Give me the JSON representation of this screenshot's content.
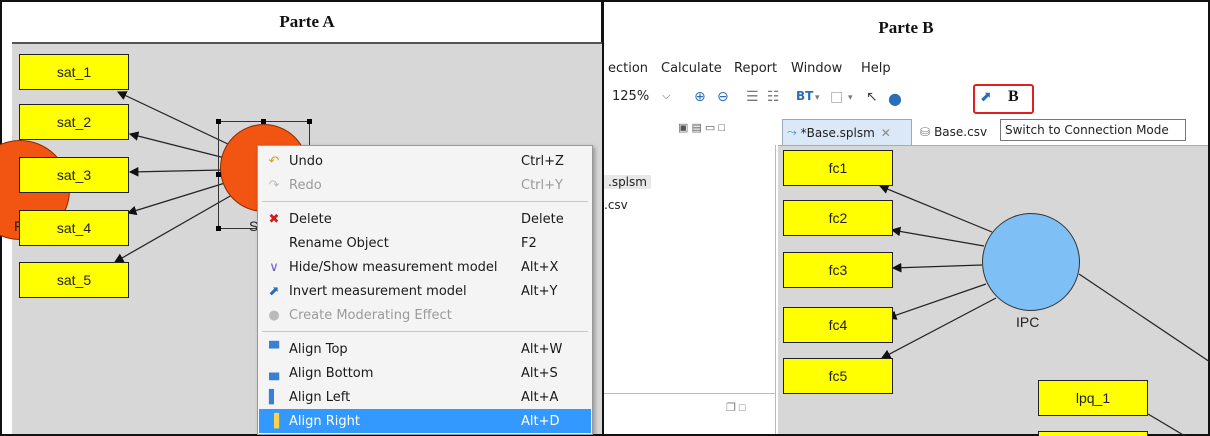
{
  "panel_a": {
    "title": "Parte A",
    "indicators": [
      "sat_1",
      "sat_2",
      "sat_3",
      "sat_4",
      "sat_5"
    ],
    "circle_label_left": "F",
    "circle_label_main": "S",
    "context_menu": [
      {
        "label": "Undo",
        "shortcut": "Ctrl+Z",
        "icon": "undo-icon",
        "disabled": false
      },
      {
        "label": "Redo",
        "shortcut": "Ctrl+Y",
        "icon": "redo-icon",
        "disabled": true
      },
      {
        "label": "Delete",
        "shortcut": "Delete",
        "icon": "delete-icon",
        "disabled": false
      },
      {
        "label": "Rename Object",
        "shortcut": "F2",
        "icon": "",
        "disabled": false
      },
      {
        "label": "Hide/Show measurement model",
        "shortcut": "Alt+X",
        "icon": "hide-show-icon",
        "disabled": false
      },
      {
        "label": "Invert measurement model",
        "shortcut": "Alt+Y",
        "icon": "invert-icon",
        "disabled": false
      },
      {
        "label": "Create Moderating Effect",
        "shortcut": "",
        "icon": "moderating-icon",
        "disabled": true
      },
      {
        "label": "Align Top",
        "shortcut": "Alt+W",
        "icon": "align-top-icon",
        "disabled": false
      },
      {
        "label": "Align Bottom",
        "shortcut": "Alt+S",
        "icon": "align-bottom-icon",
        "disabled": false
      },
      {
        "label": "Align Left",
        "shortcut": "Alt+A",
        "icon": "align-left-icon",
        "disabled": false
      },
      {
        "label": "Align Right",
        "shortcut": "Alt+D",
        "icon": "align-right-icon",
        "disabled": false,
        "highlighted": true
      }
    ]
  },
  "panel_b": {
    "title": "Parte B",
    "menu": [
      "ection",
      "Calculate",
      "Report",
      "Window",
      "Help"
    ],
    "zoom": "125%",
    "toolbar_bt": "BT",
    "toolbar_b": "B",
    "tabs": [
      {
        "label": "*Base.splsm",
        "active": true
      },
      {
        "label": "Base.csv",
        "active": false
      }
    ],
    "tooltip": "Switch to Connection Mode",
    "files": [
      ".splsm",
      ".csv"
    ],
    "indicators": [
      "fc1",
      "fc2",
      "fc3",
      "fc4",
      "fc5"
    ],
    "indicator_right": "lpq_1",
    "construct": "IPC"
  },
  "colors": {
    "indicator_fill": "#ffff00",
    "construct_red": "#f25412",
    "construct_blue": "#7ebff5",
    "highlight": "#3399ff",
    "tooltip_border_red": "#e02020"
  }
}
